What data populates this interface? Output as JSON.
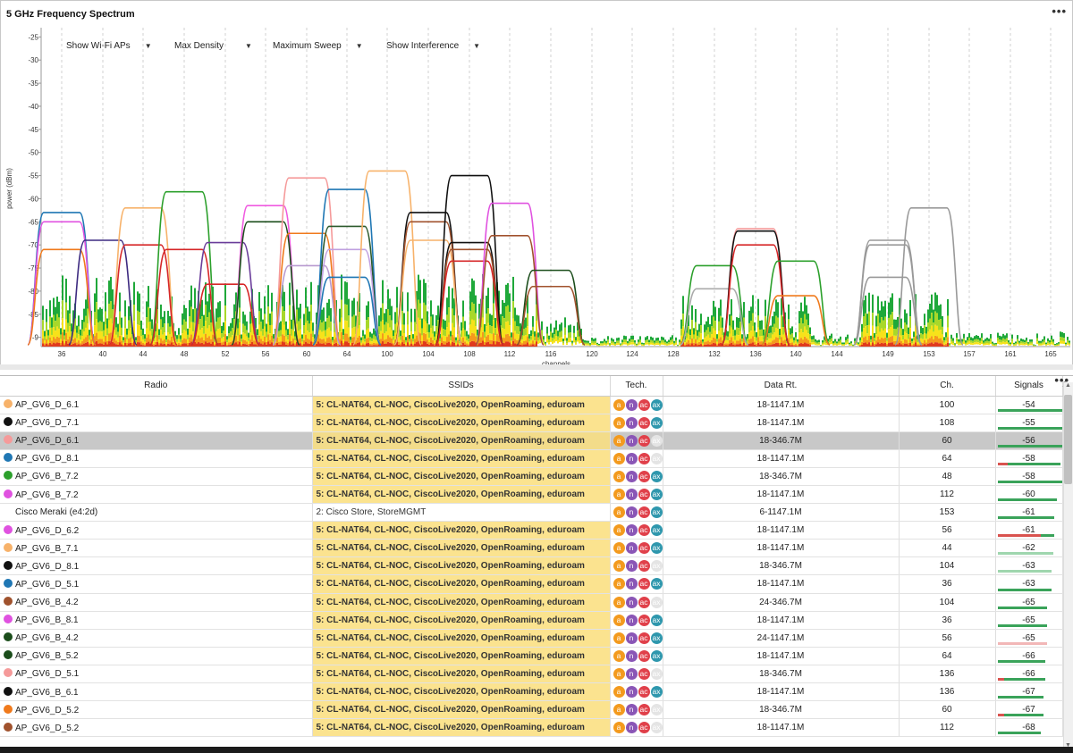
{
  "spectrum": {
    "title": "5 GHz Frequency Spectrum",
    "menu_icon": "•••",
    "controls": [
      {
        "label": "Show Wi-Fi APs",
        "icon": "chevron-down-icon"
      },
      {
        "label": "Max Density",
        "icon": "chevron-down-icon"
      },
      {
        "label": "Maximum Sweep",
        "icon": "chevron-down-icon"
      },
      {
        "label": "Show Interference",
        "icon": "chevron-down-icon"
      }
    ]
  },
  "chart_data": {
    "type": "area",
    "ylabel": "power (dBm)",
    "xlabel": "channels",
    "y_ticks": [
      "-25",
      "-30",
      "-35",
      "-40",
      "-45",
      "-50",
      "-55",
      "-60",
      "-65",
      "-70",
      "-75",
      "-80",
      "-85",
      "-9"
    ],
    "ylim": [
      -92,
      -23
    ],
    "x_ticks": [
      "36",
      "40",
      "44",
      "48",
      "52",
      "56",
      "60",
      "64",
      "100",
      "104",
      "108",
      "112",
      "116",
      "120",
      "124",
      "128",
      "132",
      "136",
      "140",
      "144",
      "149",
      "153",
      "157",
      "161",
      "165"
    ],
    "grid": "vertical dashed",
    "ap_curves": [
      {
        "channel": 36,
        "power": -63,
        "color": "#1f77b4"
      },
      {
        "channel": 36,
        "power": -65,
        "color": "#e052e0"
      },
      {
        "channel": 36,
        "power": -71,
        "color": "#f07a1c"
      },
      {
        "channel": 40,
        "power": -69,
        "color": "#3d2a80"
      },
      {
        "channel": 44,
        "power": -62,
        "color": "#f7b26a"
      },
      {
        "channel": 44,
        "power": -70,
        "color": "#d62728"
      },
      {
        "channel": 48,
        "power": -58.5,
        "color": "#2ca02c"
      },
      {
        "channel": 48,
        "power": -71,
        "color": "#d62728"
      },
      {
        "channel": 52,
        "power": -69.5,
        "color": "#6a3d9a"
      },
      {
        "channel": 52,
        "power": -78.5,
        "color": "#d62728"
      },
      {
        "channel": 56,
        "power": -61.5,
        "color": "#f05ae0"
      },
      {
        "channel": 56,
        "power": -65,
        "color": "#1b4d1b"
      },
      {
        "channel": 60,
        "power": -55.5,
        "color": "#f59a9a"
      },
      {
        "channel": 60,
        "power": -67.5,
        "color": "#f07a1c"
      },
      {
        "channel": 60,
        "power": -74.5,
        "color": "#b89ad0"
      },
      {
        "channel": 64,
        "power": -58,
        "color": "#1f77b4"
      },
      {
        "channel": 64,
        "power": -66,
        "color": "#2c5a2c"
      },
      {
        "channel": 64,
        "power": -71,
        "color": "#c0a0e0"
      },
      {
        "channel": 64,
        "power": -77,
        "color": "#1f77b4"
      },
      {
        "channel": 100,
        "power": -54,
        "color": "#f7b26a"
      },
      {
        "channel": 104,
        "power": -63,
        "color": "#111111"
      },
      {
        "channel": 104,
        "power": -65,
        "color": "#a0522d"
      },
      {
        "channel": 104,
        "power": -69,
        "color": "#f7b26a"
      },
      {
        "channel": 108,
        "power": -55,
        "color": "#111111"
      },
      {
        "channel": 108,
        "power": -69.5,
        "color": "#111111"
      },
      {
        "channel": 108,
        "power": -71,
        "color": "#a0522d"
      },
      {
        "channel": 108,
        "power": -73.5,
        "color": "#d62728"
      },
      {
        "channel": 112,
        "power": -61,
        "color": "#e052e0"
      },
      {
        "channel": 112,
        "power": -68,
        "color": "#a0522d"
      },
      {
        "channel": 116,
        "power": -75.5,
        "color": "#1b4d1b"
      },
      {
        "channel": 116,
        "power": -79,
        "color": "#a0522d"
      },
      {
        "channel": 132,
        "power": -74.5,
        "color": "#2ca02c"
      },
      {
        "channel": 132,
        "power": -79.5,
        "color": "#aaaaaa"
      },
      {
        "channel": 136,
        "power": -66.5,
        "color": "#f59a9a"
      },
      {
        "channel": 136,
        "power": -67,
        "color": "#111111"
      },
      {
        "channel": 136,
        "power": -70,
        "color": "#d62728"
      },
      {
        "channel": 140,
        "power": -73.5,
        "color": "#2ca02c"
      },
      {
        "channel": 140,
        "power": -81,
        "color": "#f07a1c"
      },
      {
        "channel": 149,
        "power": -69,
        "color": "#999999"
      },
      {
        "channel": 149,
        "power": -70,
        "color": "#999999"
      },
      {
        "channel": 149,
        "power": -77,
        "color": "#999999"
      },
      {
        "channel": 153,
        "power": -62,
        "color": "#999999"
      }
    ]
  },
  "table": {
    "menu_icon": "•••",
    "columns": [
      "Radio",
      "SSIDs",
      "Tech.",
      "Data Rt.",
      "Ch.",
      "Signals"
    ],
    "sort_icon": "sort-desc-icon",
    "rows": [
      {
        "radio": "AP_GV6_D_6.1",
        "color": "#f7b26a",
        "ssids": "5: CL-NAT64, CL-NOC, CiscoLive2020, OpenRoaming, eduroam",
        "tech": [
          "a",
          "n",
          "ac",
          "ax"
        ],
        "rate": "18-1147.1M",
        "ch": "100",
        "signal": "-54",
        "bar": 0.9,
        "red": 0
      },
      {
        "radio": "AP_GV6_D_7.1",
        "color": "#111111",
        "ssids": "5: CL-NAT64, CL-NOC, CiscoLive2020, OpenRoaming, eduroam",
        "tech": [
          "a",
          "n",
          "ac",
          "ax"
        ],
        "rate": "18-1147.1M",
        "ch": "108",
        "signal": "-55",
        "bar": 0.88,
        "red": 0
      },
      {
        "radio": "AP_GV6_D_6.1",
        "color": "#f59a9a",
        "ssids": "5: CL-NAT64, CL-NOC, CiscoLive2020, OpenRoaming, eduroam",
        "tech": [
          "a",
          "n",
          "ac",
          "off"
        ],
        "rate": "18-346.7M",
        "ch": "60",
        "signal": "-56",
        "bar": 0.86,
        "red": 0,
        "selected": true
      },
      {
        "radio": "AP_GV6_D_8.1",
        "color": "#1f77b4",
        "ssids": "5: CL-NAT64, CL-NOC, CiscoLive2020, OpenRoaming, eduroam",
        "tech": [
          "a",
          "n",
          "ac",
          "off"
        ],
        "rate": "18-1147.1M",
        "ch": "64",
        "signal": "-58",
        "bar": 0.8,
        "red": 0.12
      },
      {
        "radio": "AP_GV6_B_7.2",
        "color": "#2ca02c",
        "ssids": "5: CL-NAT64, CL-NOC, CiscoLive2020, OpenRoaming, eduroam",
        "tech": [
          "a",
          "n",
          "ac",
          "ax"
        ],
        "rate": "18-346.7M",
        "ch": "48",
        "signal": "-58",
        "bar": 0.82,
        "red": 0
      },
      {
        "radio": "AP_GV6_B_7.2",
        "color": "#e052e0",
        "ssids": "5: CL-NAT64, CL-NOC, CiscoLive2020, OpenRoaming, eduroam",
        "tech": [
          "a",
          "n",
          "ac",
          "ax"
        ],
        "rate": "18-1147.1M",
        "ch": "112",
        "signal": "-60",
        "bar": 0.75,
        "red": 0
      },
      {
        "radio": "Cisco Meraki (e4:2d)",
        "color": "",
        "ssids": "2: Cisco Store, StoreMGMT",
        "plain": true,
        "tech": [
          "a",
          "n",
          "ac",
          "ax"
        ],
        "rate": "6-1147.1M",
        "ch": "153",
        "signal": "-61",
        "bar": 0.72,
        "red": 0
      },
      {
        "radio": "AP_GV6_D_6.2",
        "color": "#e052e0",
        "ssids": "5: CL-NAT64, CL-NOC, CiscoLive2020, OpenRoaming, eduroam",
        "tech": [
          "a",
          "n",
          "ac",
          "ax"
        ],
        "rate": "18-1147.1M",
        "ch": "56",
        "signal": "-61",
        "bar": 0.72,
        "red": 0.55
      },
      {
        "radio": "AP_GV6_B_7.1",
        "color": "#f7b26a",
        "ssids": "5: CL-NAT64, CL-NOC, CiscoLive2020, OpenRoaming, eduroam",
        "tech": [
          "a",
          "n",
          "ac",
          "ax"
        ],
        "rate": "18-1147.1M",
        "ch": "44",
        "signal": "-62",
        "bar": 0.7,
        "red": 0,
        "light": true
      },
      {
        "radio": "AP_GV6_D_8.1",
        "color": "#111111",
        "ssids": "5: CL-NAT64, CL-NOC, CiscoLive2020, OpenRoaming, eduroam",
        "tech": [
          "a",
          "n",
          "ac",
          "off"
        ],
        "rate": "18-346.7M",
        "ch": "104",
        "signal": "-63",
        "bar": 0.68,
        "red": 0,
        "light": true
      },
      {
        "radio": "AP_GV6_D_5.1",
        "color": "#1f77b4",
        "ssids": "5: CL-NAT64, CL-NOC, CiscoLive2020, OpenRoaming, eduroam",
        "tech": [
          "a",
          "n",
          "ac",
          "ax"
        ],
        "rate": "18-1147.1M",
        "ch": "36",
        "signal": "-63",
        "bar": 0.68,
        "red": 0
      },
      {
        "radio": "AP_GV6_B_4.2",
        "color": "#a0522d",
        "ssids": "5: CL-NAT64, CL-NOC, CiscoLive2020, OpenRoaming, eduroam",
        "tech": [
          "a",
          "n",
          "ac",
          "off"
        ],
        "rate": "24-346.7M",
        "ch": "104",
        "signal": "-65",
        "bar": 0.62,
        "red": 0
      },
      {
        "radio": "AP_GV6_B_8.1",
        "color": "#e052e0",
        "ssids": "5: CL-NAT64, CL-NOC, CiscoLive2020, OpenRoaming, eduroam",
        "tech": [
          "a",
          "n",
          "ac",
          "ax"
        ],
        "rate": "18-1147.1M",
        "ch": "36",
        "signal": "-65",
        "bar": 0.62,
        "red": 0
      },
      {
        "radio": "AP_GV6_B_4.2",
        "color": "#1b4d1b",
        "ssids": "5: CL-NAT64, CL-NOC, CiscoLive2020, OpenRoaming, eduroam",
        "tech": [
          "a",
          "n",
          "ac",
          "ax"
        ],
        "rate": "24-1147.1M",
        "ch": "56",
        "signal": "-65",
        "bar": 0.62,
        "red": 0.62,
        "pink": true
      },
      {
        "radio": "AP_GV6_B_5.2",
        "color": "#1b4d1b",
        "ssids": "5: CL-NAT64, CL-NOC, CiscoLive2020, OpenRoaming, eduroam",
        "tech": [
          "a",
          "n",
          "ac",
          "ax"
        ],
        "rate": "18-1147.1M",
        "ch": "64",
        "signal": "-66",
        "bar": 0.6,
        "red": 0
      },
      {
        "radio": "AP_GV6_D_5.1",
        "color": "#f59a9a",
        "ssids": "5: CL-NAT64, CL-NOC, CiscoLive2020, OpenRoaming, eduroam",
        "tech": [
          "a",
          "n",
          "ac",
          "off"
        ],
        "rate": "18-346.7M",
        "ch": "136",
        "signal": "-66",
        "bar": 0.6,
        "red": 0.08
      },
      {
        "radio": "AP_GV6_B_6.1",
        "color": "#111111",
        "ssids": "5: CL-NAT64, CL-NOC, CiscoLive2020, OpenRoaming, eduroam",
        "tech": [
          "a",
          "n",
          "ac",
          "ax"
        ],
        "rate": "18-1147.1M",
        "ch": "136",
        "signal": "-67",
        "bar": 0.58,
        "red": 0
      },
      {
        "radio": "AP_GV6_D_5.2",
        "color": "#f07a1c",
        "ssids": "5: CL-NAT64, CL-NOC, CiscoLive2020, OpenRoaming, eduroam",
        "tech": [
          "a",
          "n",
          "ac",
          "off"
        ],
        "rate": "18-346.7M",
        "ch": "60",
        "signal": "-67",
        "bar": 0.58,
        "red": 0.08
      },
      {
        "radio": "AP_GV6_D_5.2",
        "color": "#a0522d",
        "ssids": "5: CL-NAT64, CL-NOC, CiscoLive2020, OpenRoaming, eduroam",
        "tech": [
          "a",
          "n",
          "ac",
          "off"
        ],
        "rate": "18-1147.1M",
        "ch": "112",
        "signal": "-68",
        "bar": 0.55,
        "red": 0
      }
    ]
  }
}
